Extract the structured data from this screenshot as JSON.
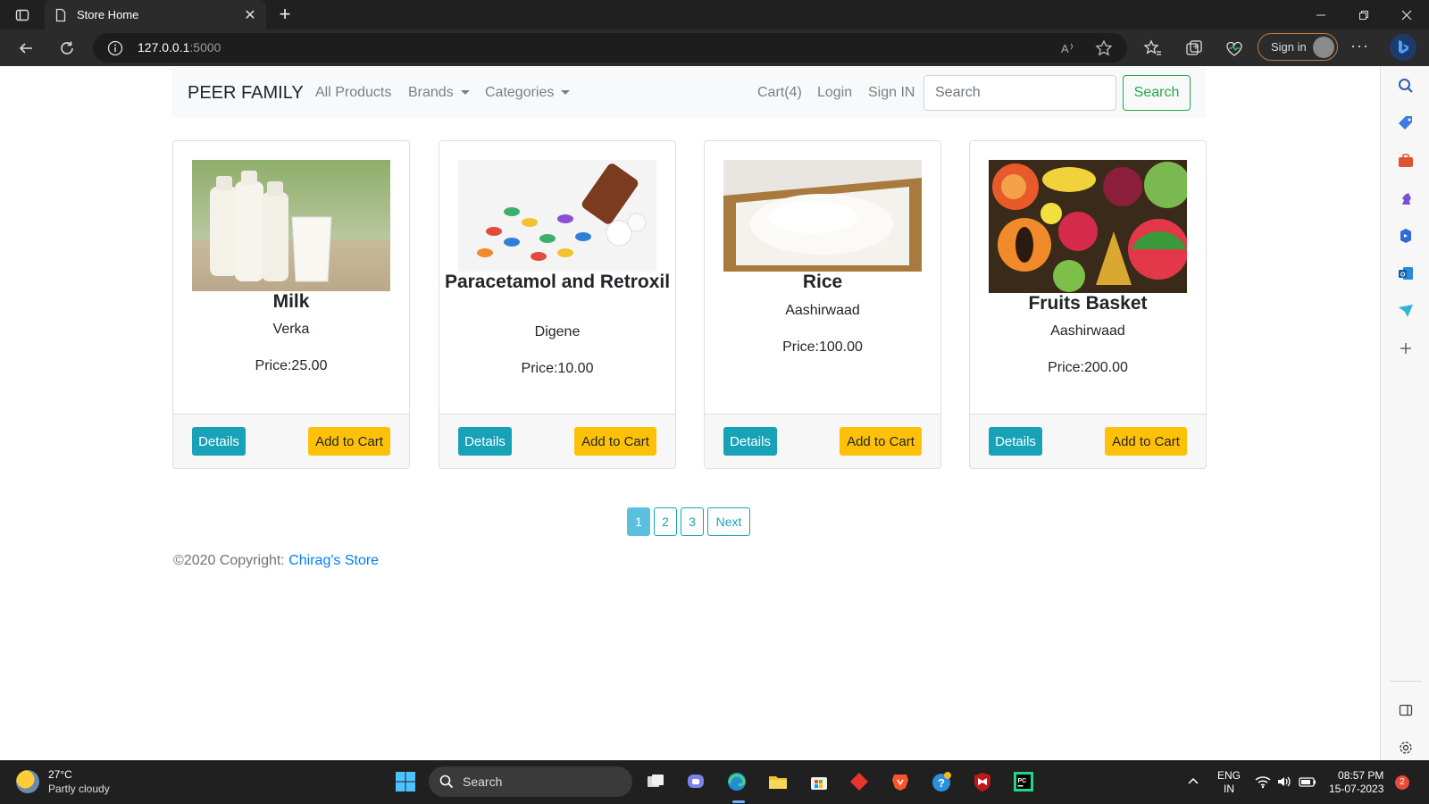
{
  "browser": {
    "tab_title": "Store Home",
    "url_host": "127.0.0.1",
    "url_port": ":5000",
    "signin_label": "Sign in",
    "new_tab_glyph": "+",
    "close_glyph": "✕",
    "more_glyph": "···"
  },
  "navbar": {
    "brand": "PEER FAMILY",
    "links": {
      "all_products": "All Products",
      "brands": "Brands",
      "categories": "Categories",
      "cart": "Cart(4)",
      "login": "Login",
      "sign_in": "Sign IN"
    },
    "search_placeholder": "Search",
    "search_button": "Search"
  },
  "products": [
    {
      "name": "Milk",
      "brand": "Verka",
      "price": "Price:25.00",
      "image": "milk-bottles-image"
    },
    {
      "name": "Paracetamol and Retroxil",
      "brand": "Digene",
      "price": "Price:10.00",
      "image": "pills-image"
    },
    {
      "name": "Rice",
      "brand": "Aashirwaad",
      "price": "Price:100.00",
      "image": "rice-image"
    },
    {
      "name": "Fruits Basket",
      "brand": "Aashirwaad",
      "price": "Price:200.00",
      "image": "fruits-image"
    }
  ],
  "card_buttons": {
    "details": "Details",
    "add_to_cart": "Add to Cart"
  },
  "pagination": {
    "pages": [
      "1",
      "2",
      "3"
    ],
    "next": "Next",
    "active": "1"
  },
  "footer": {
    "copyright": "©2020 Copyright: ",
    "store_link": "Chirag's Store"
  },
  "taskbar": {
    "weather_temp": "27°C",
    "weather_condition": "Partly cloudy",
    "search_label": "Search",
    "lang_line1": "ENG",
    "lang_line2": "IN",
    "time": "08:57 PM",
    "date": "15-07-2023",
    "notification_count": "2"
  },
  "colors": {
    "details_button": "#17a2b8",
    "cart_button": "#ffc107",
    "search_button": "#28a745",
    "link": "#007bff",
    "navbar_bg": "#f8f9fa"
  }
}
